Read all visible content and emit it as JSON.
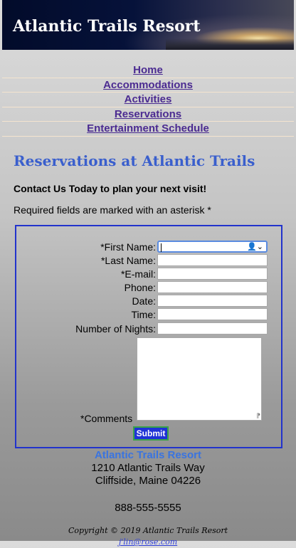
{
  "site": {
    "title": "Atlantic Trails Resort"
  },
  "nav": {
    "items": [
      {
        "label": "Home"
      },
      {
        "label": "Accommodations"
      },
      {
        "label": "Activities"
      },
      {
        "label": "Reservations"
      },
      {
        "label": "Entertainment Schedule"
      }
    ]
  },
  "main": {
    "heading": "Reservations at Atlantic Trails",
    "contact": "Contact Us Today to plan your next visit!",
    "required_note": "Required fields are marked with an asterisk *"
  },
  "form": {
    "fields": [
      {
        "label": "*First Name:",
        "value": ""
      },
      {
        "label": "*Last Name:",
        "value": ""
      },
      {
        "label": "*E-mail:",
        "value": ""
      },
      {
        "label": "Phone:",
        "value": ""
      },
      {
        "label": "Date:",
        "value": ""
      },
      {
        "label": "Time:",
        "value": ""
      },
      {
        "label": "Number of Nights:",
        "value": ""
      }
    ],
    "comments_label": "*Comments",
    "comments_value": "",
    "submit_label": "Submit",
    "autofill_icon": "contact-card-icon"
  },
  "footer": {
    "name": "Atlantic Trails Resort",
    "address1": "1210 Atlantic Trails Way",
    "address2": "Cliffside, Maine 04226",
    "phone": "888-555-5555",
    "copyright": "Copyright © 2019 Atlantic Trails Resort",
    "email": "j'lin@rose.com"
  },
  "colors": {
    "header_bg": "#06123a",
    "nav_link": "#4b2b91",
    "heading": "#3a5fcd",
    "form_border": "#2233cc",
    "submit_bg": "#1f32d6",
    "footer_name": "#3a74e0",
    "email_link": "#2d3ed9"
  }
}
